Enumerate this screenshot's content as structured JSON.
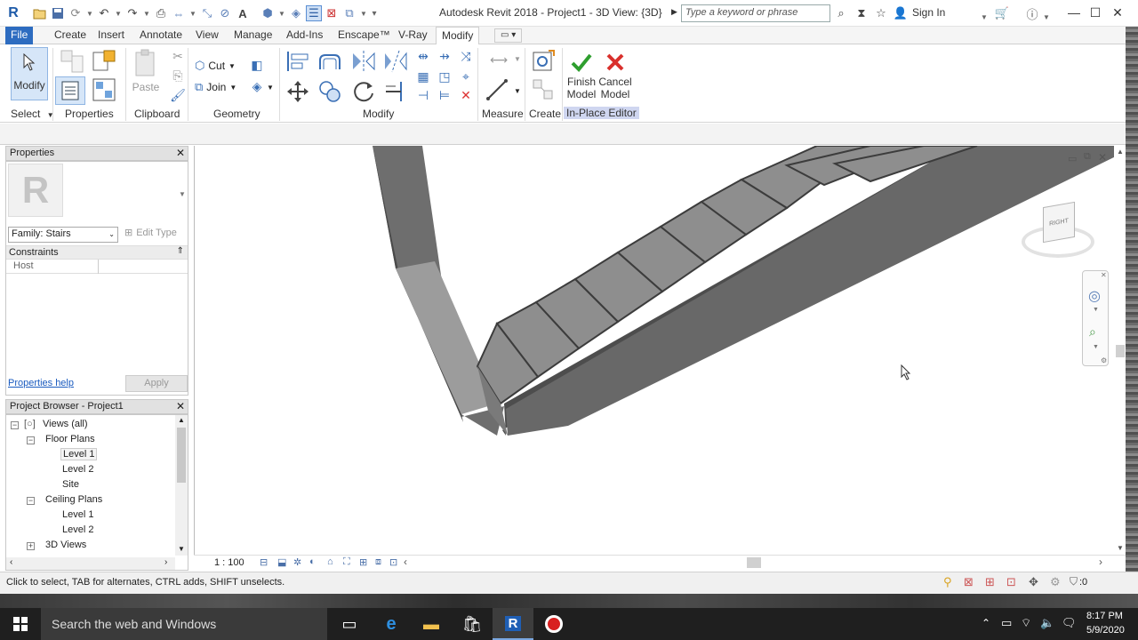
{
  "title_bar": {
    "app_title": "Autodesk Revit 2018 -    Project1 - 3D View: {3D}",
    "search_placeholder": "Type a keyword or phrase",
    "sign_in": "Sign In"
  },
  "ribbon_tabs": [
    {
      "label": "File"
    },
    {
      "label": "Create"
    },
    {
      "label": "Insert"
    },
    {
      "label": "Annotate"
    },
    {
      "label": "View"
    },
    {
      "label": "Manage"
    },
    {
      "label": "Add-Ins"
    },
    {
      "label": "Enscape™"
    },
    {
      "label": "V-Ray"
    },
    {
      "label": "Modify"
    }
  ],
  "ribbon": {
    "modify_button": "Modify",
    "select_label": "Select",
    "properties_label": "Properties",
    "paste_label": "Paste",
    "clipboard_label": "Clipboard",
    "cut_label": "Cut",
    "join_label": "Join",
    "geometry_label": "Geometry",
    "modify_panel_label": "Modify",
    "measure_label": "Measure",
    "create_label": "Create",
    "finish_line1": "Finish",
    "finish_line2": "Model",
    "cancel_line1": "Cancel",
    "cancel_line2": "Model",
    "inplace_label": "In-Place Editor"
  },
  "properties_panel": {
    "header": "Properties",
    "type_icon_letter": "R",
    "family_select": "Family: Stairs",
    "edit_type": "Edit Type",
    "section_constraints": "Constraints",
    "row_host": "Host",
    "help_link": "Properties help",
    "apply": "Apply"
  },
  "project_browser": {
    "header": "Project Browser - Project1",
    "items": [
      {
        "label": "Views (all)"
      },
      {
        "label": "Floor Plans"
      },
      {
        "label": "Level 1"
      },
      {
        "label": "Level 2"
      },
      {
        "label": "Site"
      },
      {
        "label": "Ceiling Plans"
      },
      {
        "label": "Level 1"
      },
      {
        "label": "Level 2"
      },
      {
        "label": "3D Views"
      }
    ]
  },
  "viewcube": {
    "face_label": "RIGHT"
  },
  "view_control": {
    "scale": "1 : 100"
  },
  "status": {
    "message": "Click to select, TAB for alternates, CTRL adds, SHIFT unselects.",
    "filter_count": ":0"
  },
  "taskbar": {
    "search_placeholder": "Search the web and Windows",
    "time": "8:17 PM",
    "date": "5/9/2020"
  },
  "colors": {
    "file_tab": "#2d6cc0",
    "stair_tread": "#8e8e8e",
    "stair_side": "#5f5f5f",
    "finish_check": "#2e9e2e",
    "cancel_x": "#d9302c",
    "taskbar": "#1f1f1f"
  }
}
